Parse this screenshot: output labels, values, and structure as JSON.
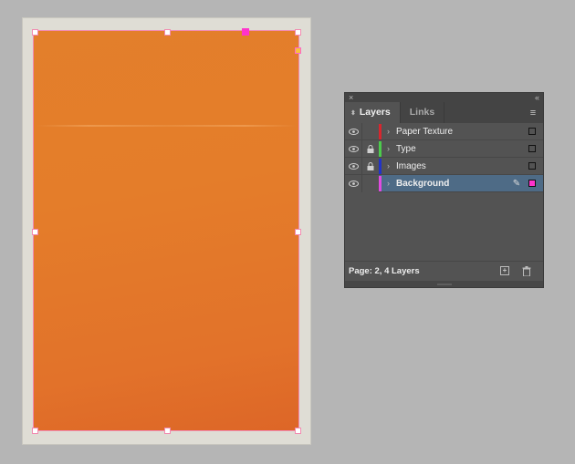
{
  "document": {
    "page_color": "#e37f2b",
    "frame_color": "#ff33cc"
  },
  "layers_panel": {
    "close_label": "×",
    "collapse_label": "«",
    "tabs": [
      {
        "label": "Layers",
        "active": true
      },
      {
        "label": "Links",
        "active": false
      }
    ],
    "menu_icon": "≡",
    "layers": [
      {
        "name": "Paper Texture",
        "color": "#d7262e",
        "visible": true,
        "locked": false,
        "selected": false
      },
      {
        "name": "Type",
        "color": "#4ccb4c",
        "visible": true,
        "locked": true,
        "selected": false
      },
      {
        "name": "Images",
        "color": "#2233c8",
        "visible": true,
        "locked": true,
        "selected": false
      },
      {
        "name": "Background",
        "color": "#e04be0",
        "visible": true,
        "locked": false,
        "selected": true
      }
    ],
    "icons": {
      "eye": "👁",
      "lock": "🔒",
      "chevron": "›",
      "pen": "✎",
      "trash": "🗑",
      "new_layer": "+"
    },
    "status": "Page: 2, 4 Layers"
  }
}
